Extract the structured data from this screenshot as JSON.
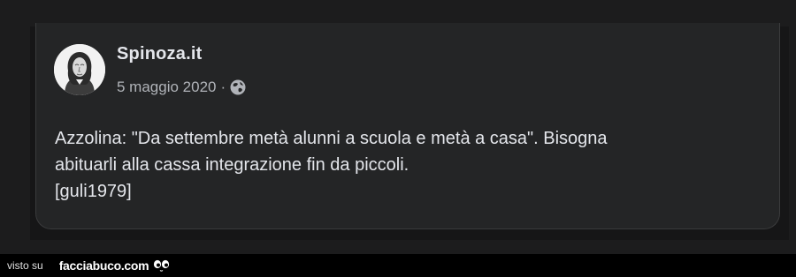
{
  "post": {
    "author": "Spinoza.it",
    "date": "5 maggio 2020",
    "separator": "·",
    "privacy_icon": "globe-icon",
    "avatar_icon": "portrait-avatar-icon",
    "lines": [
      "Azzolina: \"Da settembre metà alunni a scuola e metà a casa\". Bisogna",
      "abituarli alla cassa integrazione fin da piccoli.",
      "[guli1979]"
    ]
  },
  "footer": {
    "visto_su": "visto su",
    "brand": "facciabuco.com",
    "brand_icon": "eyes-icon"
  },
  "colors": {
    "page_background": "#1c1c1d",
    "card_background": "#242526",
    "card_border": "#3a3b3c",
    "primary_text": "#e4e6eb",
    "secondary_text": "#b0b3b8",
    "footer_background": "#000000"
  }
}
